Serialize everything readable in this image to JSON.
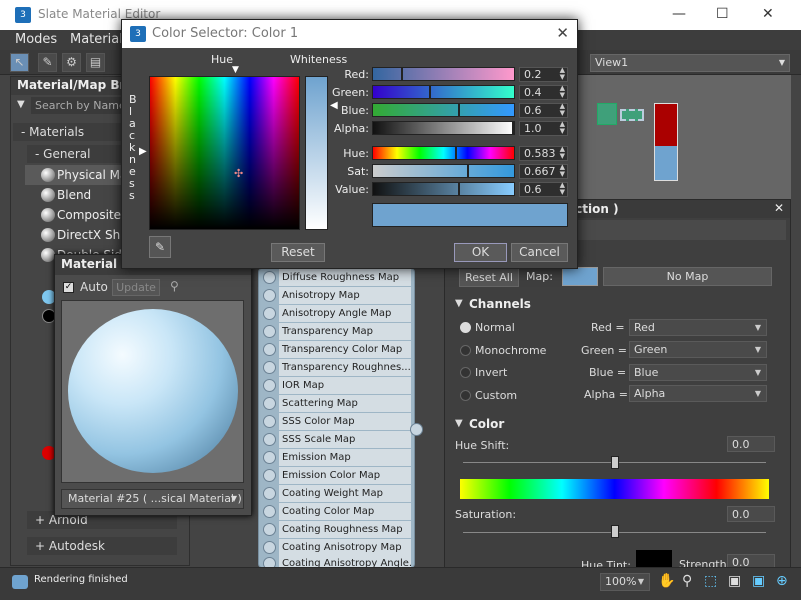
{
  "window": {
    "title": "Slate Material Editor",
    "app_icon": "3"
  },
  "menu": [
    "Modes",
    "Material"
  ],
  "toolbar": {
    "view_select": "View1"
  },
  "browser": {
    "title": "Material/Map Brow",
    "search_placeholder": "Search by Name ...",
    "rollout_materials": "- Materials",
    "rollout_general": "- General",
    "items": [
      "Physical Ma",
      "Blend",
      "Composite",
      "DirectX Shad",
      "Double Sid"
    ],
    "rollout_arnold": "+ Arnold",
    "rollout_autodesk": "+ Autodesk"
  },
  "preview": {
    "title": "Material #2",
    "auto_label": "Auto",
    "update_label": "Update",
    "dropdown": "Material #25  ( ...sical Material )"
  },
  "node_slots": [
    "Diffuse Roughness Map",
    "Anisotropy Map",
    "Anisotropy Angle Map",
    "Transparency Map",
    "Transparency Color Map",
    "Transparency Roughnes...",
    "IOR Map",
    "Scattering Map",
    "SSS Color Map",
    "SSS Scale Map",
    "Emission Map",
    "Emission Color Map",
    "Coating Weight Map",
    "Coating Color Map",
    "Coating Roughness Map",
    "Coating Anisotropy Map",
    "Coating Anisotropy Angle..."
  ],
  "props": {
    "title": "ection )",
    "reset_all": "Reset All",
    "map_label": "Map:",
    "no_map": "No Map",
    "channels_head": "Channels",
    "modes": [
      "Normal",
      "Monochrome",
      "Invert",
      "Custom"
    ],
    "channel_labels": [
      "Red =",
      "Green =",
      "Blue =",
      "Alpha ="
    ],
    "channel_values": [
      "Red",
      "Green",
      "Blue",
      "Alpha"
    ],
    "color_head": "Color",
    "hue_shift_label": "Hue Shift:",
    "hue_shift_value": "0.0",
    "saturation_label": "Saturation:",
    "saturation_value": "0.0",
    "hue_tint_label": "Hue Tint:",
    "strength_label": "Strength:",
    "strength_value": "0.0"
  },
  "dialog": {
    "title": "Color Selector: Color 1",
    "hue_label": "Hue",
    "whiteness_label": "Whiteness",
    "blackness_label": "B l a c k n e s s",
    "fields": [
      {
        "label": "Red:",
        "value": "0.2"
      },
      {
        "label": "Green:",
        "value": "0.4"
      },
      {
        "label": "Blue:",
        "value": "0.6"
      },
      {
        "label": "Alpha:",
        "value": "1.0"
      },
      {
        "label": "Hue:",
        "value": "0.583"
      },
      {
        "label": "Sat:",
        "value": "0.667"
      },
      {
        "label": "Value:",
        "value": "0.6"
      }
    ],
    "reset": "Reset",
    "ok": "OK",
    "cancel": "Cancel",
    "current_color": "#6fa3cf"
  },
  "status": {
    "text": "Rendering finished",
    "zoom": "100%"
  }
}
